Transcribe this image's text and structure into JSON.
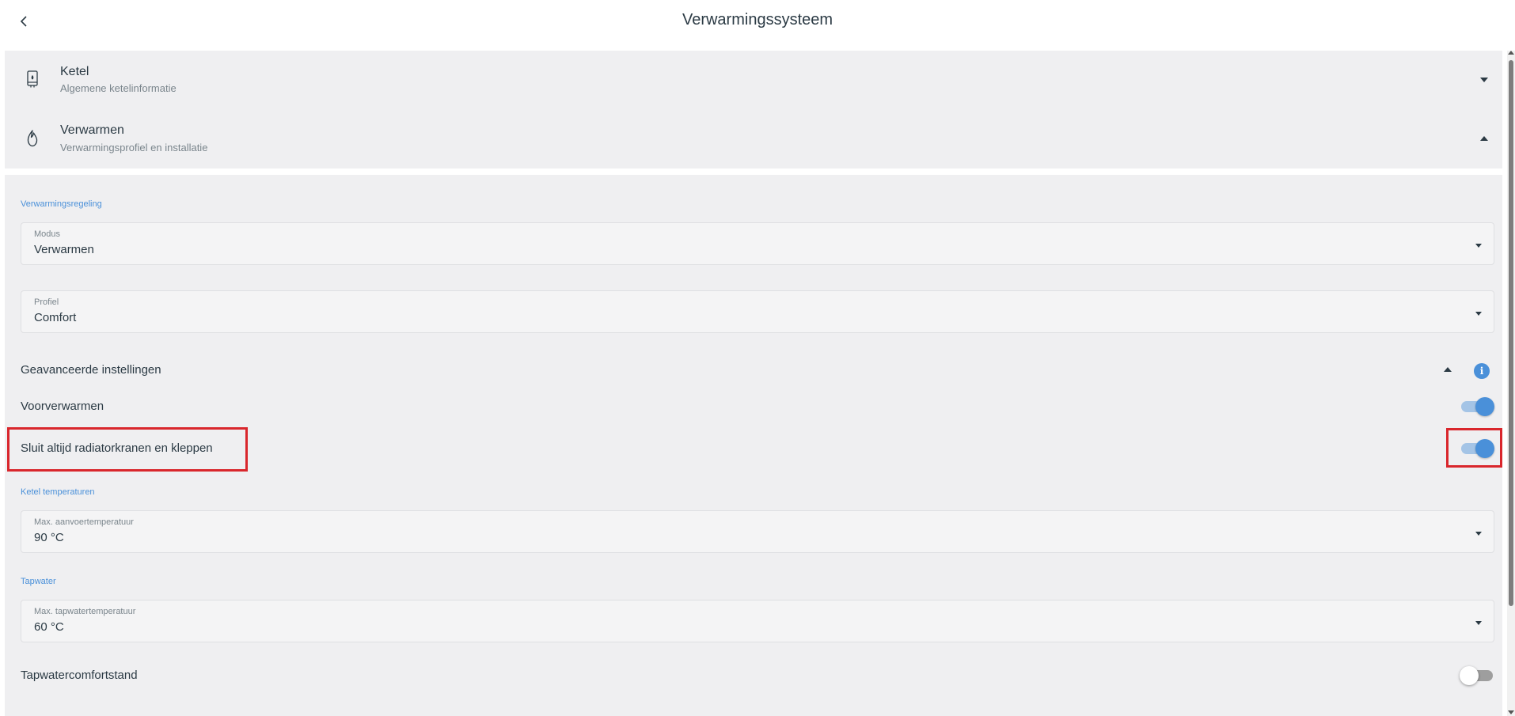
{
  "header": {
    "title": "Verwarmingssysteem",
    "back_icon": "chevron-left-icon"
  },
  "accordion": {
    "ketel": {
      "title": "Ketel",
      "subtitle": "Algemene ketelinformatie",
      "icon": "boiler-icon",
      "expanded": false
    },
    "verwarmen": {
      "title": "Verwarmen",
      "subtitle": "Verwarmingsprofiel en installatie",
      "icon": "flame-icon",
      "expanded": true
    }
  },
  "heating_control": {
    "section_label": "Verwarmingsregeling",
    "modus": {
      "label": "Modus",
      "value": "Verwarmen"
    },
    "profiel": {
      "label": "Profiel",
      "value": "Comfort"
    }
  },
  "advanced": {
    "label": "Geavanceerde instellingen",
    "expanded": true,
    "info_icon": "info-icon",
    "info_glyph": "i"
  },
  "settings": {
    "voorverwarmen": {
      "label": "Voorverwarmen",
      "on": true
    },
    "sluit_kranen": {
      "label": "Sluit altijd radiatorkranen en kleppen",
      "on": true,
      "highlighted": true
    }
  },
  "ketel_temperaturen": {
    "section_label": "Ketel temperaturen",
    "max_aanvoer": {
      "label": "Max. aanvoertemperatuur",
      "value": "90 °C"
    }
  },
  "tapwater": {
    "section_label": "Tapwater",
    "max_tapwater": {
      "label": "Max. tapwatertemperatuur",
      "value": "60 °C"
    },
    "comfortstand": {
      "label": "Tapwatercomfortstand",
      "on": false
    }
  },
  "colors": {
    "accent": "#4a90d9",
    "highlight": "#d9262c",
    "card_bg": "#efeff1",
    "text": "#2b3a44"
  }
}
